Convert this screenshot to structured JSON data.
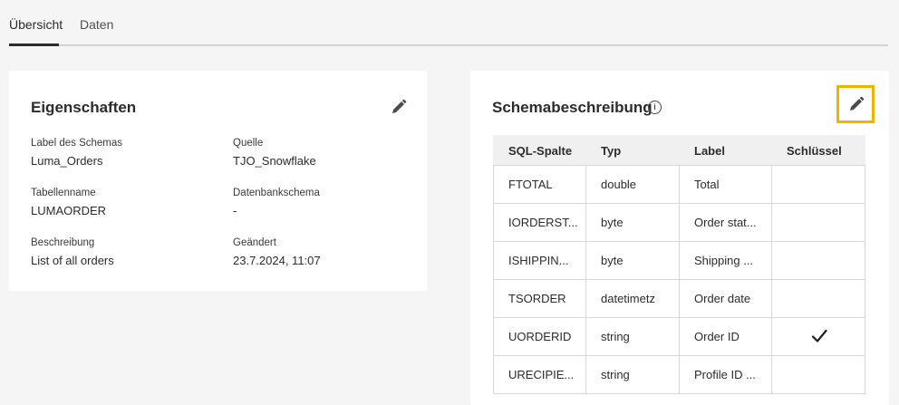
{
  "tabs": [
    {
      "label": "Übersicht",
      "active": true
    },
    {
      "label": "Daten",
      "active": false
    }
  ],
  "properties": {
    "title": "Eigenschaften",
    "edit_icon": "pencil-icon",
    "fields": [
      {
        "label": "Label des Schemas",
        "value": "Luma_Orders"
      },
      {
        "label": "Quelle",
        "value": "TJO_Snowflake"
      },
      {
        "label": "Tabellenname",
        "value": "LUMAORDER"
      },
      {
        "label": "Datenbankschema",
        "value": "-"
      },
      {
        "label": "Beschreibung",
        "value": "List of all orders"
      },
      {
        "label": "Geändert",
        "value": "23.7.2024, 11:07"
      }
    ]
  },
  "schema": {
    "title": "Schemabeschreibung",
    "info_icon": "info-icon",
    "edit_icon": "pencil-icon",
    "highlight_color": "#f0b400",
    "columns": [
      "SQL-Spalte",
      "Typ",
      "Label",
      "Schlüssel"
    ],
    "rows": [
      {
        "sql": "FTOTAL",
        "type": "double",
        "label": "Total",
        "key": false
      },
      {
        "sql": "IORDERST...",
        "type": "byte",
        "label": "Order stat...",
        "key": false
      },
      {
        "sql": "ISHIPPIN...",
        "type": "byte",
        "label": "Shipping ...",
        "key": false
      },
      {
        "sql": "TSORDER",
        "type": "datetimetz",
        "label": "Order date",
        "key": false
      },
      {
        "sql": "UORDERID",
        "type": "string",
        "label": "Order ID",
        "key": true
      },
      {
        "sql": "URECIPIE...",
        "type": "string",
        "label": "Profile ID ...",
        "key": false
      }
    ]
  }
}
